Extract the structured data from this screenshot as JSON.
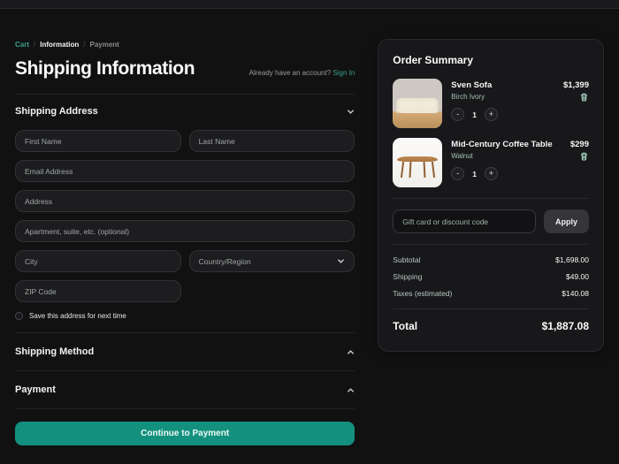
{
  "colors": {
    "accent_teal": "#14907f",
    "link_teal": "#3aa28d",
    "variant_sage": "#a3c2b2",
    "page_bg": "#111112",
    "panel_bg": "#18181b"
  },
  "breadcrumb": {
    "separator": "/",
    "items": [
      {
        "label": "Cart"
      },
      {
        "label": "Information"
      },
      {
        "label": "Payment"
      }
    ]
  },
  "header": {
    "title": "Shipping Information",
    "account_prompt": "Already have an account?",
    "sign_in_label": "Sign In"
  },
  "sections": {
    "shipping_address": {
      "title": "Shipping Address"
    },
    "shipping_method": {
      "title": "Shipping Method"
    },
    "payment": {
      "title": "Payment"
    }
  },
  "form": {
    "first_name_placeholder": "First Name",
    "last_name_placeholder": "Last Name",
    "email_placeholder": "Email Address",
    "address_placeholder": "Address",
    "apartment_placeholder": "Apartment, suite, etc. (optional)",
    "city_placeholder": "City",
    "country_label": "Country/Region",
    "zip_placeholder": "ZIP Code",
    "save_address_label": "Save this address for next time"
  },
  "continue_button_label": "Continue to Payment",
  "order_summary": {
    "title": "Order Summary",
    "items": [
      {
        "name": "Sven Sofa",
        "variant": "Birch Ivory",
        "price": "$1,399",
        "qty": "1",
        "minus": "-",
        "plus": "+",
        "image_alt": "sofa-thumbnail"
      },
      {
        "name": "Mid-Century Coffee Table",
        "variant": "Walnut",
        "price": "$299",
        "qty": "1",
        "minus": "-",
        "plus": "+",
        "image_alt": "coffee-table-thumbnail"
      }
    ],
    "gift_card": {
      "placeholder": "Gift card or discount code",
      "apply_label": "Apply"
    },
    "totals": [
      {
        "label": "Subtotal",
        "value": "$1,698.00"
      },
      {
        "label": "Shipping",
        "value": "$49.00"
      },
      {
        "label": "Taxes (estimated)",
        "value": "$140.08"
      }
    ],
    "grand_total": {
      "label": "Total",
      "value": "$1,887.08"
    }
  }
}
